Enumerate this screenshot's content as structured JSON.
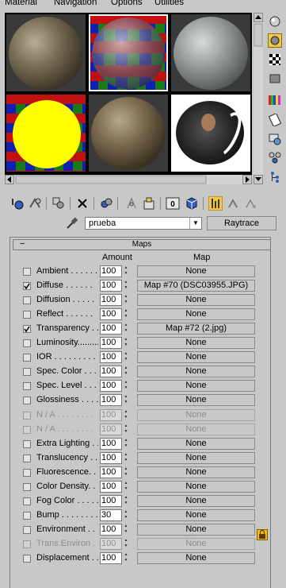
{
  "menu": {
    "items": [
      "Material",
      "Navigation",
      "Options",
      "Utilities"
    ]
  },
  "material": {
    "name": "prueba",
    "type_button": "Raytrace"
  },
  "rollout": {
    "title": "Maps",
    "collapse_symbol": "−",
    "col_amount": "Amount",
    "col_map": "Map"
  },
  "maps": [
    {
      "label": "Ambient . . . . . .",
      "checked": false,
      "amount": "100",
      "map": "None",
      "enabled": true
    },
    {
      "label": "Diffuse . . . . . .",
      "checked": true,
      "amount": "100",
      "map": "Map #70 (DSC03955.JPG)",
      "enabled": true
    },
    {
      "label": "Diffusion . . . . .",
      "checked": false,
      "amount": "100",
      "map": "None",
      "enabled": true
    },
    {
      "label": "Reflect . . . . . .",
      "checked": false,
      "amount": "100",
      "map": "None",
      "enabled": true
    },
    {
      "label": "Transparency . .",
      "checked": true,
      "amount": "100",
      "map": "Map #72 (2.jpg)",
      "enabled": true
    },
    {
      "label": "Luminosity.........",
      "checked": false,
      "amount": "100",
      "map": "None",
      "enabled": true
    },
    {
      "label": "IOR . . . . . . . . .",
      "checked": false,
      "amount": "100",
      "map": "None",
      "enabled": true
    },
    {
      "label": "Spec. Color . . . .",
      "checked": false,
      "amount": "100",
      "map": "None",
      "enabled": true
    },
    {
      "label": "Spec. Level . . . .",
      "checked": false,
      "amount": "100",
      "map": "None",
      "enabled": true
    },
    {
      "label": "Glossiness . . . .",
      "checked": false,
      "amount": "100",
      "map": "None",
      "enabled": true
    },
    {
      "label": "N / A . . . . . . . .",
      "checked": false,
      "amount": "100",
      "map": "None",
      "enabled": false
    },
    {
      "label": "N / A . . . . . . . .",
      "checked": false,
      "amount": "100",
      "map": "None",
      "enabled": false
    },
    {
      "label": "Extra Lighting . .",
      "checked": false,
      "amount": "100",
      "map": "None",
      "enabled": true
    },
    {
      "label": "Translucency . . .",
      "checked": false,
      "amount": "100",
      "map": "None",
      "enabled": true
    },
    {
      "label": "Fluorescence. . .",
      "checked": false,
      "amount": "100",
      "map": "None",
      "enabled": true
    },
    {
      "label": "Color Density. . .",
      "checked": false,
      "amount": "100",
      "map": "None",
      "enabled": true
    },
    {
      "label": "Fog Color . . . . .",
      "checked": false,
      "amount": "100",
      "map": "None",
      "enabled": true
    },
    {
      "label": "Bump . . . . . . . .",
      "checked": false,
      "amount": "30",
      "map": "None",
      "enabled": true
    },
    {
      "label": "Environment . . .",
      "checked": false,
      "amount": "100",
      "map": "None",
      "enabled": true
    },
    {
      "label": "Trans.Environ . .",
      "checked": false,
      "amount": "100",
      "map": "None",
      "enabled": false
    },
    {
      "label": "Displacement . .",
      "checked": false,
      "amount": "100",
      "map": "None",
      "enabled": true
    }
  ],
  "colors": {
    "background": "#c8c8c8",
    "slot_active_outline": "#ffffff",
    "lock_icon": "#f6c000",
    "toggle_active": "#f0c848"
  }
}
